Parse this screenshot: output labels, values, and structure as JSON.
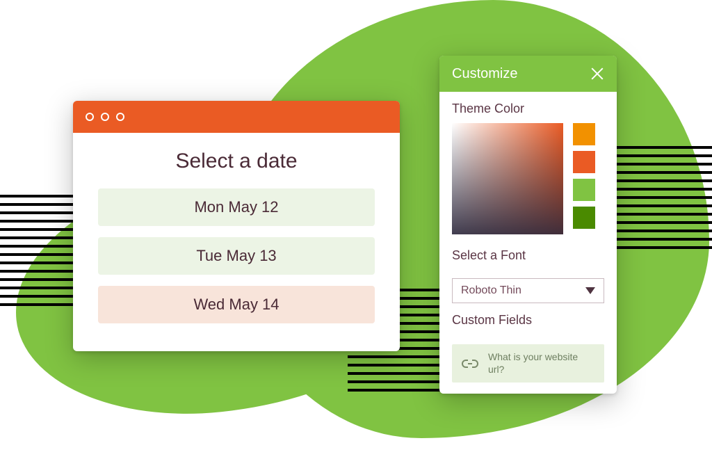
{
  "date_window": {
    "title": "Select a date",
    "options": [
      {
        "label": "Mon May 12",
        "selected": false
      },
      {
        "label": "Tue May 13",
        "selected": false
      },
      {
        "label": "Wed May 14",
        "selected": true
      }
    ]
  },
  "customize": {
    "title": "Customize",
    "theme_label": "Theme Color",
    "swatches": [
      "#f29100",
      "#ea5b24",
      "#80c342",
      "#4a8a00"
    ],
    "font_label": "Select a Font",
    "font_value": "Roboto Thin",
    "custom_fields_label": "Custom Fields",
    "field_prompt": "What is your website url?"
  },
  "colors": {
    "accent_green": "#80c342",
    "accent_orange": "#ea5b24"
  }
}
